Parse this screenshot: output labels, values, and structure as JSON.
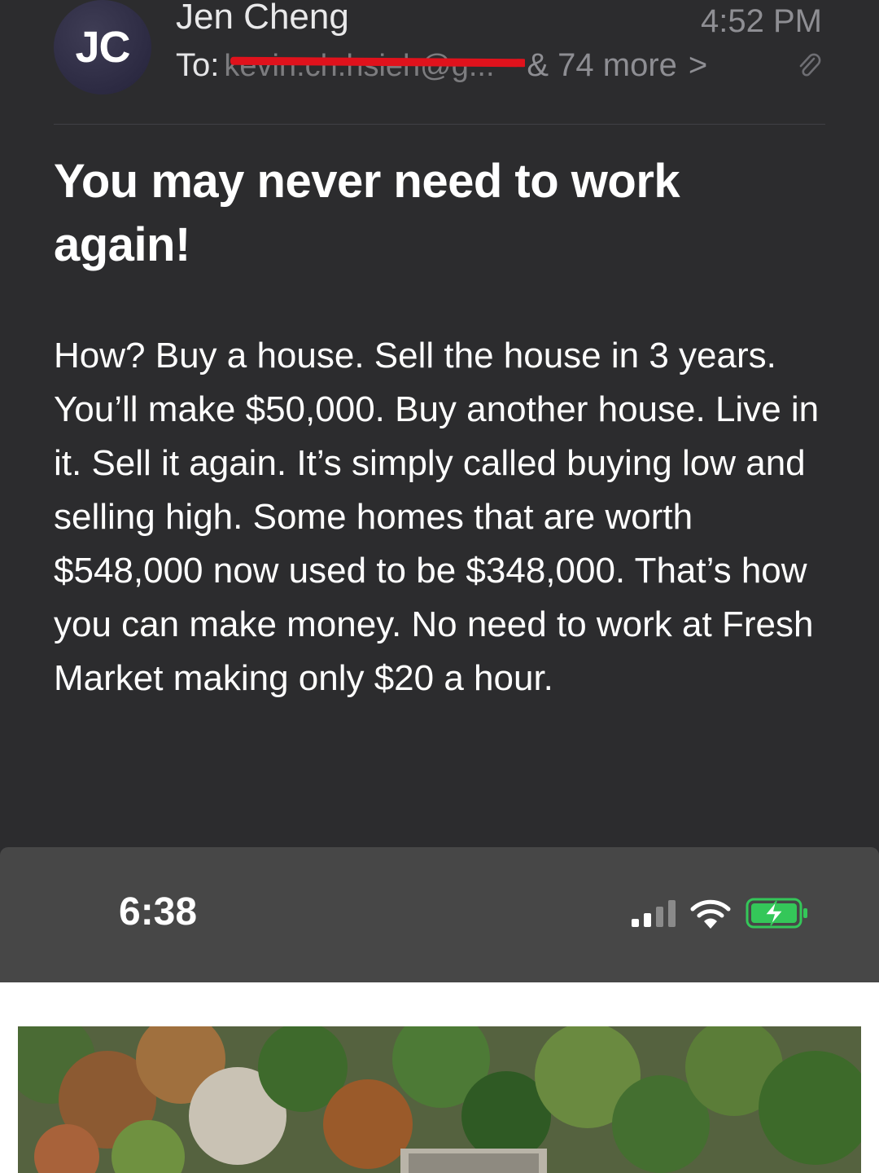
{
  "email": {
    "avatar_initials": "JC",
    "sender_name": "Jen Cheng",
    "time": "4:52 PM",
    "to_label": "To:",
    "recipient_redacted": "kevin.ch.hsieh@g...",
    "more_recipients": "& 74 more",
    "chevron": ">",
    "subject": "You may never need to work again!",
    "body": "How?  Buy a house.  Sell the house in 3 years.  You’ll make $50,000.  Buy another house.  Live in it.  Sell it again.  It’s simply called buying low and selling high.  Some homes that are worth $548,000 now used to be $348,000.  That’s how you can make money.  No need to work at Fresh Market making only $20 a hour."
  },
  "status_bar": {
    "time": "6:38",
    "icons": [
      "cellular-signal-icon",
      "wifi-icon",
      "battery-charging-icon"
    ]
  },
  "colors": {
    "background": "#2c2c2e",
    "redaction": "#e0121c",
    "battery": "#34c759"
  }
}
